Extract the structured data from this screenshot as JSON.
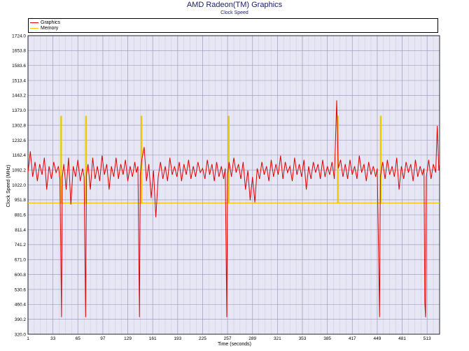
{
  "header": {
    "title": "AMD Radeon(TM) Graphics",
    "subtitle": "Clock Speed"
  },
  "chart_data": {
    "type": "line",
    "title": "AMD Radeon(TM) Graphics",
    "subtitle": "Clock Speed",
    "xlabel": "Time (seconds)",
    "ylabel": "Clock Speed (MHz)",
    "xlim": [
      1,
      529
    ],
    "ylim": [
      320.0,
      1724.0
    ],
    "x_ticks": [
      "1",
      "33",
      "65",
      "97",
      "129",
      "161",
      "193",
      "225",
      "257",
      "289",
      "321",
      "353",
      "385",
      "417",
      "449",
      "481",
      "513"
    ],
    "y_ticks": [
      "1724.0",
      "1653.8",
      "1583.6",
      "1513.4",
      "1443.2",
      "1373.0",
      "1302.8",
      "1232.6",
      "1162.4",
      "1092.2",
      "1022.0",
      "951.8",
      "881.6",
      "811.4",
      "741.2",
      "671.0",
      "600.8",
      "530.6",
      "460.4",
      "390.2",
      "320.0"
    ],
    "grid": true,
    "legend_position": "top",
    "series": [
      {
        "name": "Graphics",
        "color": "#e00000",
        "points": [
          [
            1,
            1080
          ],
          [
            4,
            1180
          ],
          [
            7,
            1060
          ],
          [
            10,
            1130
          ],
          [
            13,
            1040
          ],
          [
            16,
            1120
          ],
          [
            19,
            1070
          ],
          [
            22,
            1150
          ],
          [
            25,
            1000
          ],
          [
            28,
            1110
          ],
          [
            31,
            1050
          ],
          [
            34,
            1130
          ],
          [
            37,
            1080
          ],
          [
            40,
            1110
          ],
          [
            42,
            1050
          ],
          [
            44,
            400
          ],
          [
            45,
            1060
          ],
          [
            47,
            1120
          ],
          [
            50,
            1000
          ],
          [
            53,
            1150
          ],
          [
            56,
            930
          ],
          [
            59,
            1110
          ],
          [
            62,
            1060
          ],
          [
            65,
            1140
          ],
          [
            68,
            1040
          ],
          [
            71,
            1100
          ],
          [
            73,
            1060
          ],
          [
            75,
            400
          ],
          [
            76,
            1070
          ],
          [
            78,
            1120
          ],
          [
            81,
            1000
          ],
          [
            84,
            1150
          ],
          [
            87,
            1050
          ],
          [
            90,
            1110
          ],
          [
            93,
            1040
          ],
          [
            96,
            1160
          ],
          [
            99,
            1070
          ],
          [
            102,
            1120
          ],
          [
            105,
            1000
          ],
          [
            108,
            1110
          ],
          [
            111,
            1060
          ],
          [
            114,
            1150
          ],
          [
            117,
            1050
          ],
          [
            120,
            1120
          ],
          [
            123,
            1070
          ],
          [
            126,
            1140
          ],
          [
            129,
            1040
          ],
          [
            132,
            1110
          ],
          [
            135,
            1060
          ],
          [
            138,
            1130
          ],
          [
            140,
            1080
          ],
          [
            142,
            1110
          ],
          [
            144,
            400
          ],
          [
            145,
            1070
          ],
          [
            147,
            1140
          ],
          [
            150,
            1200
          ],
          [
            153,
            1040
          ],
          [
            156,
            1120
          ],
          [
            159,
            960
          ],
          [
            162,
            1090
          ],
          [
            165,
            870
          ],
          [
            168,
            1060
          ],
          [
            171,
            1130
          ],
          [
            174,
            1050
          ],
          [
            177,
            1110
          ],
          [
            180,
            1040
          ],
          [
            183,
            1150
          ],
          [
            186,
            1070
          ],
          [
            189,
            1110
          ],
          [
            192,
            1060
          ],
          [
            195,
            1130
          ],
          [
            198,
            1040
          ],
          [
            201,
            1120
          ],
          [
            204,
            1070
          ],
          [
            207,
            1140
          ],
          [
            210,
            1050
          ],
          [
            213,
            1110
          ],
          [
            216,
            1060
          ],
          [
            219,
            1130
          ],
          [
            222,
            1080
          ],
          [
            225,
            1100
          ],
          [
            228,
            1050
          ],
          [
            231,
            1140
          ],
          [
            234,
            1070
          ],
          [
            237,
            1120
          ],
          [
            240,
            1040
          ],
          [
            243,
            1130
          ],
          [
            246,
            1060
          ],
          [
            249,
            1110
          ],
          [
            252,
            1050
          ],
          [
            254,
            1100
          ],
          [
            256,
            400
          ],
          [
            257,
            1070
          ],
          [
            259,
            1130
          ],
          [
            262,
            1060
          ],
          [
            265,
            1150
          ],
          [
            268,
            1080
          ],
          [
            271,
            1120
          ],
          [
            274,
            1050
          ],
          [
            277,
            1130
          ],
          [
            280,
            1000
          ],
          [
            283,
            1090
          ],
          [
            286,
            950
          ],
          [
            289,
            1060
          ],
          [
            292,
            940
          ],
          [
            295,
            1100
          ],
          [
            298,
            1050
          ],
          [
            301,
            1130
          ],
          [
            304,
            1070
          ],
          [
            307,
            1110
          ],
          [
            310,
            1040
          ],
          [
            313,
            1140
          ],
          [
            316,
            1060
          ],
          [
            319,
            1120
          ],
          [
            322,
            1070
          ],
          [
            325,
            1160
          ],
          [
            328,
            1050
          ],
          [
            331,
            1130
          ],
          [
            334,
            1080
          ],
          [
            337,
            1110
          ],
          [
            340,
            1040
          ],
          [
            343,
            1150
          ],
          [
            346,
            1070
          ],
          [
            349,
            1120
          ],
          [
            352,
            1060
          ],
          [
            355,
            1140
          ],
          [
            358,
            1000
          ],
          [
            361,
            1110
          ],
          [
            364,
            1050
          ],
          [
            367,
            1130
          ],
          [
            370,
            1080
          ],
          [
            373,
            1120
          ],
          [
            376,
            1050
          ],
          [
            379,
            1140
          ],
          [
            382,
            1060
          ],
          [
            385,
            1110
          ],
          [
            388,
            1070
          ],
          [
            391,
            1130
          ],
          [
            394,
            1050
          ],
          [
            397,
            1420
          ],
          [
            399,
            1100
          ],
          [
            402,
            1140
          ],
          [
            405,
            1060
          ],
          [
            408,
            1120
          ],
          [
            411,
            1050
          ],
          [
            414,
            1140
          ],
          [
            417,
            1070
          ],
          [
            420,
            1110
          ],
          [
            423,
            1050
          ],
          [
            426,
            1160
          ],
          [
            429,
            1080
          ],
          [
            432,
            1120
          ],
          [
            435,
            1040
          ],
          [
            438,
            1130
          ],
          [
            441,
            1070
          ],
          [
            444,
            1110
          ],
          [
            447,
            1060
          ],
          [
            449,
            1100
          ],
          [
            451,
            640
          ],
          [
            452,
            400
          ],
          [
            453,
            1060
          ],
          [
            456,
            1130
          ],
          [
            459,
            1050
          ],
          [
            462,
            1140
          ],
          [
            465,
            1070
          ],
          [
            468,
            1110
          ],
          [
            471,
            1060
          ],
          [
            474,
            1150
          ],
          [
            477,
            1000
          ],
          [
            480,
            1110
          ],
          [
            483,
            1050
          ],
          [
            486,
            1130
          ],
          [
            489,
            1080
          ],
          [
            492,
            1120
          ],
          [
            495,
            1040
          ],
          [
            498,
            1140
          ],
          [
            501,
            1060
          ],
          [
            504,
            1110
          ],
          [
            507,
            1070
          ],
          [
            509,
            1100
          ],
          [
            510,
            470
          ],
          [
            511,
            400
          ],
          [
            512,
            1060
          ],
          [
            515,
            1140
          ],
          [
            518,
            1050
          ],
          [
            521,
            1120
          ],
          [
            524,
            1080
          ],
          [
            526,
            1300
          ],
          [
            528,
            1090
          ],
          [
            529,
            1120
          ]
        ]
      },
      {
        "name": "Memory",
        "color": "#f0c800",
        "points": [
          [
            1,
            937
          ],
          [
            43,
            937
          ],
          [
            43,
            1345
          ],
          [
            44,
            1345
          ],
          [
            44,
            937
          ],
          [
            75,
            937
          ],
          [
            75,
            1345
          ],
          [
            76,
            1345
          ],
          [
            76,
            937
          ],
          [
            146,
            937
          ],
          [
            146,
            1345
          ],
          [
            147,
            1345
          ],
          [
            147,
            937
          ],
          [
            258,
            937
          ],
          [
            258,
            1345
          ],
          [
            259,
            1345
          ],
          [
            259,
            937
          ],
          [
            398,
            937
          ],
          [
            398,
            1345
          ],
          [
            399,
            1345
          ],
          [
            399,
            937
          ],
          [
            453,
            937
          ],
          [
            453,
            1345
          ],
          [
            454,
            1345
          ],
          [
            454,
            937
          ],
          [
            529,
            937
          ]
        ]
      }
    ]
  }
}
